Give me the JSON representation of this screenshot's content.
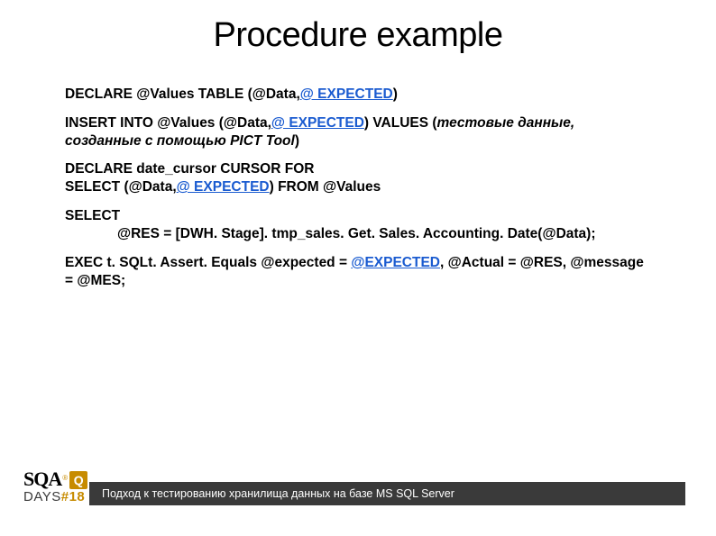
{
  "title": "Procedure example",
  "lines": {
    "l1a": "DECLARE @Values TABLE (@Data,",
    "l1b": "@ EXPECTED",
    "l1c": ")",
    "l2a": "INSERT INTO @Values (@Data,",
    "l2b": "@ EXPECTED",
    "l2c": ")       VALUES (",
    "l2d": "тестовые данные, созданные с помощью PICT Tool",
    "l2e": ")",
    "l3a": "DECLARE date_cursor CURSOR FOR",
    "l3b": "SELECT (@Data,",
    "l3c": "@ EXPECTED",
    "l3d": ") FROM @Values",
    "l4a": "SELECT",
    "l4b": "@RES = [DWH. Stage]. tmp_sales. Get. Sales. Accounting. Date(@Data);",
    "l5a": "EXEC t. SQLt. Assert. Equals @expected = ",
    "l5b": "@EXPECTED",
    "l5c": ", @Actual = @RES, @message = @MES;"
  },
  "footer": "Подход к тестированию хранилища данных на базе MS SQL Server",
  "logo": {
    "sqa": "SQA",
    "reg": "®",
    "q": "Q",
    "days": "DAYS",
    "num": "#18"
  }
}
